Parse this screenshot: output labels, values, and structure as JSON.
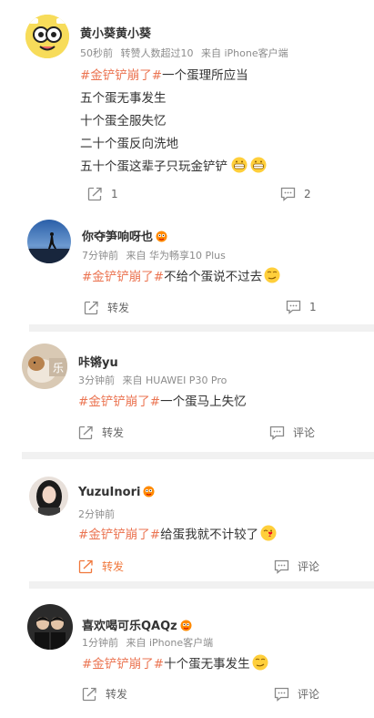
{
  "posts": [
    {
      "name": "黄小葵黄小葵",
      "time": "50秒前",
      "extra": "转赞人数超过10",
      "source": "来自 iPhone客户端",
      "tag": "#金铲铲崩了#",
      "lines": [
        "一个蛋理所应当",
        "五个蛋无事发生",
        "十个蛋全服失忆",
        "二十个蛋反向洗地",
        "五十个蛋这辈子只玩金铲铲"
      ],
      "repost": "1",
      "comment": "2"
    },
    {
      "name": "你夺笋响呀也",
      "time": "7分钟前",
      "source": "来自 华为畅享10 Plus",
      "tag": "#金铲铲崩了#",
      "text": "不给个蛋说不过去",
      "repost": "转发",
      "comment": "1"
    },
    {
      "name": "咔锵yu",
      "time": "3分钟前",
      "source": "来自 HUAWEI P30 Pro",
      "tag": "#金铲铲崩了#",
      "text": "一个蛋马上失忆",
      "repost": "转发",
      "comment": "评论"
    },
    {
      "name": "YuzuInori",
      "time": "2分钟前",
      "tag": "#金铲铲崩了#",
      "text": "给蛋我就不计较了",
      "repost": "转发",
      "comment": "评论"
    },
    {
      "name": "喜欢喝可乐QAQz",
      "time": "1分钟前",
      "source": "来自 iPhone客户端",
      "tag": "#金铲铲崩了#",
      "text": "十个蛋无事发生",
      "repost": "转发",
      "comment": "评论"
    }
  ],
  "colors": {
    "tag": "#eb7350",
    "active": "#f0773b",
    "meta": "#8c8c8c"
  }
}
